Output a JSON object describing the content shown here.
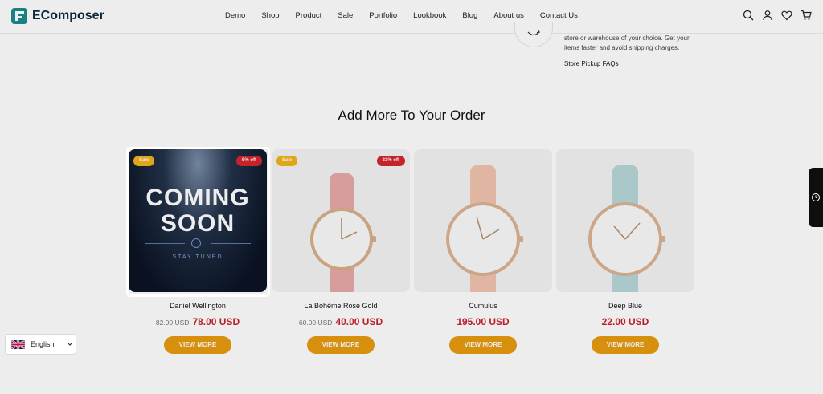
{
  "brand": {
    "name": "EComposer"
  },
  "nav": {
    "items": [
      "Demo",
      "Shop",
      "Product",
      "Sale",
      "Portfolio",
      "Lookbook",
      "Blog",
      "About us",
      "Contact Us"
    ]
  },
  "pickup": {
    "text": "store or warehouse of your choice. Get your items faster and avoid shipping charges.",
    "link": "Store Pickup FAQs"
  },
  "section": {
    "title": "Add More To Your Order"
  },
  "products": [
    {
      "name": "Daniel Wellington",
      "old_price": "82.00 USD",
      "price": "78.00 USD",
      "badge_sale": "Sale",
      "badge_off": "5% off",
      "button": "VIEW MORE",
      "image": {
        "line1": "COMING",
        "line2": "SOON",
        "line3": "STAY TUNED"
      }
    },
    {
      "name": "La Bohème Rose Gold",
      "old_price": "60.00 USD",
      "price": "40.00 USD",
      "badge_sale": "Sale",
      "badge_off": "33% off",
      "button": "VIEW MORE",
      "strap_color": "#e8a9a8"
    },
    {
      "name": "Cumulus",
      "old_price": "",
      "price": "195.00 USD",
      "button": "VIEW MORE",
      "strap_color": "#f2c3ae"
    },
    {
      "name": "Deep Blue",
      "old_price": "",
      "price": "22.00 USD",
      "button": "VIEW MORE",
      "strap_color": "#b7d8d9"
    }
  ],
  "language": {
    "label": "English"
  },
  "colors": {
    "accent": "#e89b0e",
    "price": "#c9222c",
    "sale_badge": "#f0b31a",
    "off_badge": "#d3262e"
  }
}
